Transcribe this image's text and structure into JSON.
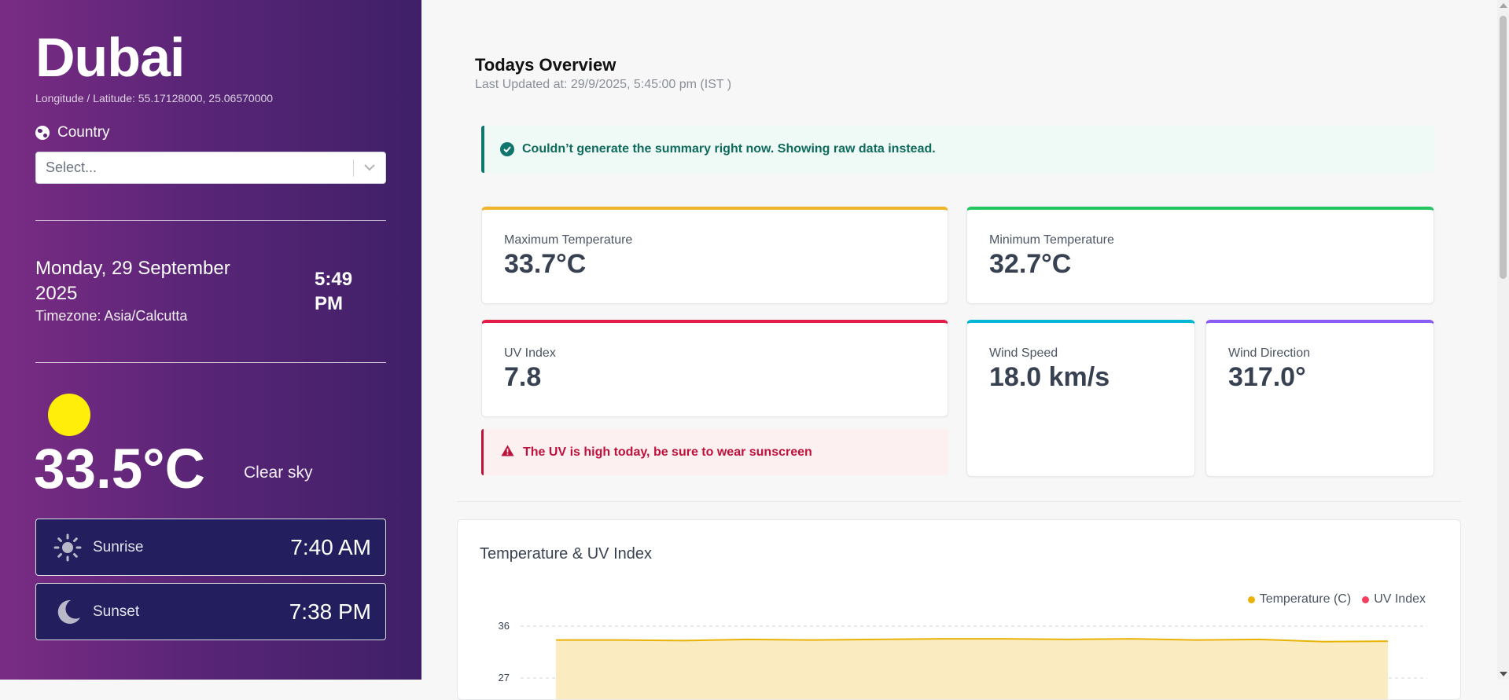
{
  "sidebar": {
    "city": "Dubai",
    "coords": "Longitude / Latitude: 55.17128000, 25.06570000",
    "country_label": "Country",
    "country_placeholder": "Select...",
    "date": "Monday, 29 September 2025",
    "timezone": "Timezone: Asia/Calcutta",
    "time": "5:49 PM",
    "temperature": "33.5°C",
    "condition": "Clear sky",
    "sunrise_label": "Sunrise",
    "sunrise_value": "7:40 AM",
    "sunset_label": "Sunset",
    "sunset_value": "7:38 PM"
  },
  "main": {
    "title": "Todays Overview",
    "updated": "Last Updated at: 29/9/2025, 5:45:00 pm (IST )",
    "summary_alert": "Couldn’t generate the summary right now. Showing raw data instead.",
    "uv_alert": "The UV is high today, be sure to wear sunscreen",
    "cards": {
      "max_temp": {
        "label": "Maximum Temperature",
        "value": "33.7°C"
      },
      "min_temp": {
        "label": "Minimum Temperature",
        "value": "32.7°C"
      },
      "uv_index": {
        "label": "UV Index",
        "value": "7.8"
      },
      "wind_speed": {
        "label": "Wind Speed",
        "value": "18.0 km/s"
      },
      "wind_direction": {
        "label": "Wind Direction",
        "value": "317.0°"
      }
    }
  },
  "colors": {
    "sidebar_gradient": [
      "#7a2c84",
      "#3f2068"
    ],
    "max_temp_accent": "#f0b429",
    "min_temp_accent": "#22c55e",
    "uv_accent": "#e11d48",
    "wind_speed_accent": "#06b6d4",
    "wind_direction_accent": "#8b5cf6",
    "temperature_series": "#eab308",
    "uv_series": "#f43f5e"
  },
  "icons": [
    "globe-icon",
    "chevron-down-icon",
    "sun-icon",
    "moon-icon",
    "check-circle-icon",
    "warning-icon"
  ],
  "chart_data": {
    "type": "area",
    "title": "Temperature & UV Index",
    "legend_position": "top-right",
    "grid": true,
    "y_ticks": [
      36,
      27
    ],
    "series": [
      {
        "name": "Temperature (C)",
        "values": [
          33.6,
          33.6,
          33.5,
          33.7,
          33.6,
          33.7,
          33.8,
          33.8,
          33.7,
          33.8,
          33.6,
          33.7,
          33.3,
          33.4
        ]
      },
      {
        "name": "UV Index",
        "values": []
      }
    ]
  }
}
